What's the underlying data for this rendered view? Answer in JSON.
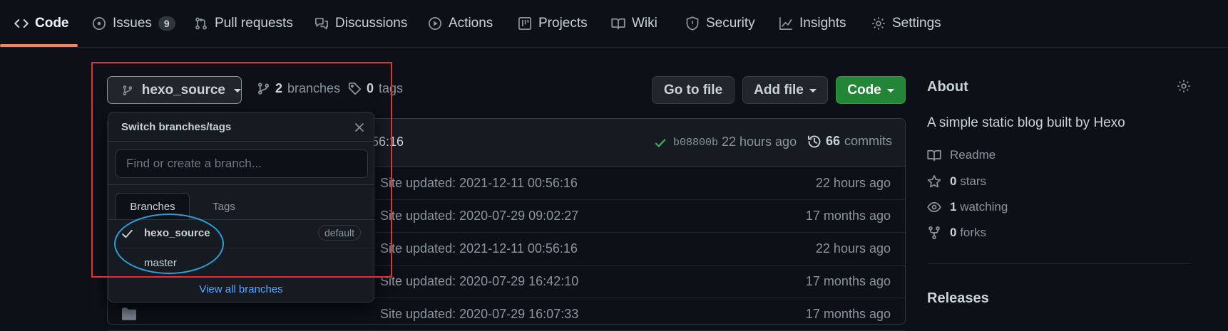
{
  "nav": {
    "tabs": [
      {
        "label": "Code",
        "icon": "code-icon"
      },
      {
        "label": "Issues",
        "icon": "issue-opened-icon",
        "count": "9"
      },
      {
        "label": "Pull requests",
        "icon": "git-pull-request-icon"
      },
      {
        "label": "Discussions",
        "icon": "comment-discussion-icon"
      },
      {
        "label": "Actions",
        "icon": "play-icon"
      },
      {
        "label": "Projects",
        "icon": "table-icon"
      },
      {
        "label": "Wiki",
        "icon": "book-icon"
      },
      {
        "label": "Security",
        "icon": "shield-icon"
      },
      {
        "label": "Insights",
        "icon": "graph-icon"
      },
      {
        "label": "Settings",
        "icon": "gear-icon"
      }
    ],
    "active_tab": "Code",
    "accent_color": "#f78166"
  },
  "toolbar": {
    "branch_button": "hexo_source",
    "branches_count": "2",
    "branches_label": "branches",
    "tags_count": "0",
    "tags_label": "tags",
    "go_to_file": "Go to file",
    "add_file": "Add file",
    "code": "Code"
  },
  "commit_bar": {
    "message_fragment": "56:16",
    "sha": "b08800b",
    "time": "22 hours ago",
    "commits_count": "66",
    "commits_label": "commits",
    "status_color": "#3fb950"
  },
  "files": [
    {
      "message": "Site updated: 2021-12-11 00:56:16",
      "age": "22 hours ago"
    },
    {
      "message": "Site updated: 2020-07-29 09:02:27",
      "age": "17 months ago"
    },
    {
      "message": "Site updated: 2021-12-11 00:56:16",
      "age": "22 hours ago"
    },
    {
      "message": "Site updated: 2020-07-29 16:42:10",
      "age": "17 months ago"
    },
    {
      "message": "Site updated: 2020-07-29 16:07:33",
      "age": "17 months ago"
    }
  ],
  "dropdown": {
    "title": "Switch branches/tags",
    "filter_placeholder": "Find or create a branch...",
    "tabs": [
      "Branches",
      "Tags"
    ],
    "active_tab": "Branches",
    "branches": [
      {
        "name": "hexo_source",
        "selected": true,
        "badge": "default"
      },
      {
        "name": "master",
        "selected": false
      }
    ],
    "view_all": "View all branches",
    "link_color": "#58a6ff"
  },
  "annotations": {
    "box_color": "#e5312f",
    "ellipse_color": "#2b9fd9"
  },
  "sidebar": {
    "about_title": "About",
    "description": "A simple static blog built by Hexo",
    "readme": "Readme",
    "stars_count": "0",
    "stars_label": "stars",
    "watching_count": "1",
    "watching_label": "watching",
    "forks_count": "0",
    "forks_label": "forks",
    "releases_title": "Releases"
  }
}
